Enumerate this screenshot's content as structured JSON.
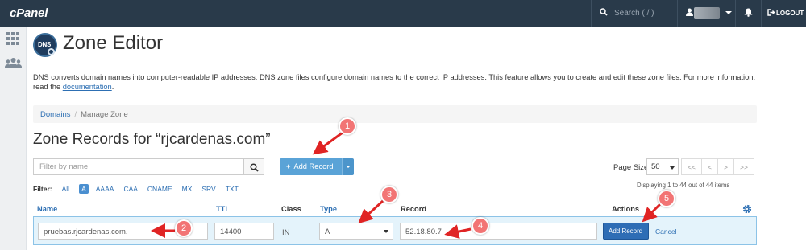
{
  "header": {
    "logo": "cPanel",
    "search_placeholder": "Search ( / )",
    "logout_label": "LOGOUT",
    "icons": [
      "search-icon",
      "user-icon",
      "bell-icon",
      "logout-icon"
    ]
  },
  "sidebar": {
    "icons": [
      "apps-grid-icon",
      "users-icon"
    ]
  },
  "page": {
    "icon_text": "DNS",
    "title": "Zone Editor",
    "description": "DNS converts domain names into computer-readable IP addresses. DNS zone files configure domain names to the correct IP addresses. This feature allows you to create and edit these zone files. For more information, read the",
    "doc_link": "documentation",
    "doc_suffix": "."
  },
  "breadcrumb": {
    "items": [
      "Domains",
      "Manage Zone"
    ],
    "separator": "/"
  },
  "records": {
    "title": "Zone Records for “rjcardenas.com”",
    "filter_placeholder": "Filter by name",
    "add_record_label": "Add Record",
    "page_size_label": "Page Size",
    "page_size_value": "50",
    "pager": [
      "<<",
      "<",
      ">",
      ">>"
    ],
    "filter_label": "Filter:",
    "filter_options": [
      "All",
      "A",
      "AAAA",
      "CAA",
      "CNAME",
      "MX",
      "SRV",
      "TXT"
    ],
    "active_filter": "A",
    "displaying": "Displaying 1 to 44 out of 44 items"
  },
  "table": {
    "columns": [
      "Name",
      "TTL",
      "Class",
      "Type",
      "Record",
      "Actions"
    ],
    "edit_row": {
      "name": "pruebas.rjcardenas.com.",
      "ttl": "14400",
      "class": "IN",
      "type": "A",
      "record": "52.18.80.7",
      "add_button": "Add Record",
      "cancel": "Cancel"
    }
  },
  "annotations": [
    "1",
    "2",
    "3",
    "4",
    "5"
  ],
  "colors": {
    "topbar": "#293a4a",
    "primary": "#5aa3d7",
    "link": "#2d6fb3",
    "badge": "#f27474",
    "arrow": "#e02424"
  }
}
